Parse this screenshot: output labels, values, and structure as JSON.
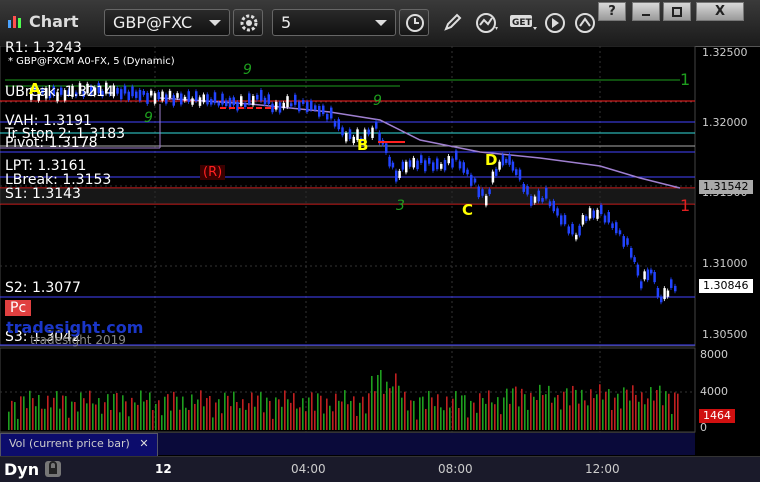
{
  "toolbar": {
    "title": "Chart",
    "symbol": "GBP@FXC",
    "interval": "5",
    "help": "?",
    "close": "X"
  },
  "chart": {
    "desc": "* GBP@FXCM A0-FX, 5 (Dynamic)",
    "watermark": "tradesight.com",
    "copyright": "tradesight 2019",
    "levels": [
      {
        "text": "R1: 1.3243",
        "color": "#ff2020"
      },
      {
        "text": "UBreak: 1.3214",
        "color": "#ff2020"
      },
      {
        "text": "VAH: 1.3191",
        "color": "#4444ff"
      },
      {
        "text": "Tr Stop 2: 1.3183",
        "color": "#33dddd"
      },
      {
        "text": "Pivot: 1.3178",
        "color": "#aaaaaa"
      },
      {
        "text": "LPT: 1.3161",
        "color": "#4444ff"
      },
      {
        "text": "LBreak: 1.3153",
        "color": "#ff2020"
      },
      {
        "text": "S1: 1.3143",
        "color": "#ff2020"
      },
      {
        "text": "S2: 1.3077",
        "color": "#4444ff"
      },
      {
        "text": "S3: 1.3042",
        "color": "#4444ff"
      }
    ],
    "pc_label": "Pc",
    "r_label": "(R)",
    "markers": [
      "A",
      "B",
      "C",
      "D"
    ],
    "counts": {
      "nine_a": "9",
      "nine_b": "9",
      "nine_c": "9",
      "three": "3"
    },
    "right_marks": {
      "one_green": "1",
      "one_red": "1"
    },
    "price_ticks": [
      "1.32500",
      "1.32000",
      "1.31500",
      "1.31000",
      "1.30500"
    ],
    "current_price": "1.31542",
    "low_price": "1.30846",
    "vol_ticks": [
      "8000",
      "4000",
      "0"
    ],
    "vol_value": "1464",
    "vol_label": "Vol (current price bar)",
    "time_ticks": [
      "12",
      "04:00",
      "08:00",
      "12:00"
    ],
    "dyn": "Dyn",
    "colors": {
      "up": "#ffffff",
      "down": "#2244ff",
      "vwap": "#9f7fcf",
      "green": "#1e9e1e"
    }
  }
}
